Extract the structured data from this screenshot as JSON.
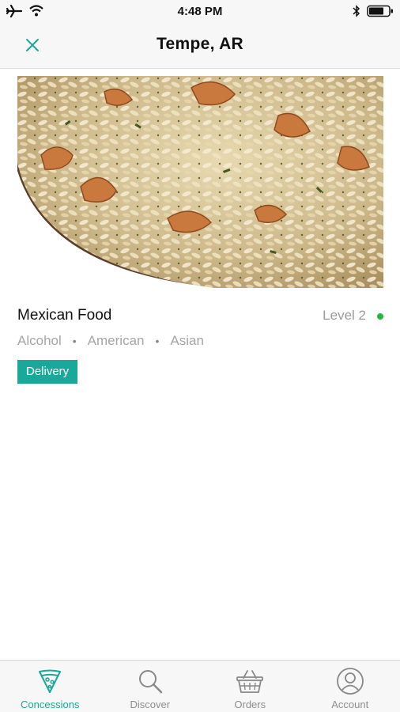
{
  "status_bar": {
    "time": "4:48 PM",
    "icons": [
      "airplane-icon",
      "wifi-icon",
      "bluetooth-icon",
      "battery-icon"
    ]
  },
  "header": {
    "title": "Tempe, AR",
    "close_icon": "close-icon"
  },
  "item": {
    "title": "Mexican Food",
    "level": "Level 2",
    "level_status_color": "#1fba3c",
    "tags": [
      "Alcohol",
      "American",
      "Asian"
    ],
    "tag_separator": "•",
    "badge": "Delivery"
  },
  "tab_bar": {
    "active_color": "#1aa89a",
    "tabs": [
      {
        "label": "Concessions",
        "icon": "pizza-slice-icon",
        "active": true
      },
      {
        "label": "Discover",
        "icon": "search-icon",
        "active": false
      },
      {
        "label": "Orders",
        "icon": "basket-icon",
        "active": false
      },
      {
        "label": "Account",
        "icon": "user-icon",
        "active": false
      }
    ]
  }
}
